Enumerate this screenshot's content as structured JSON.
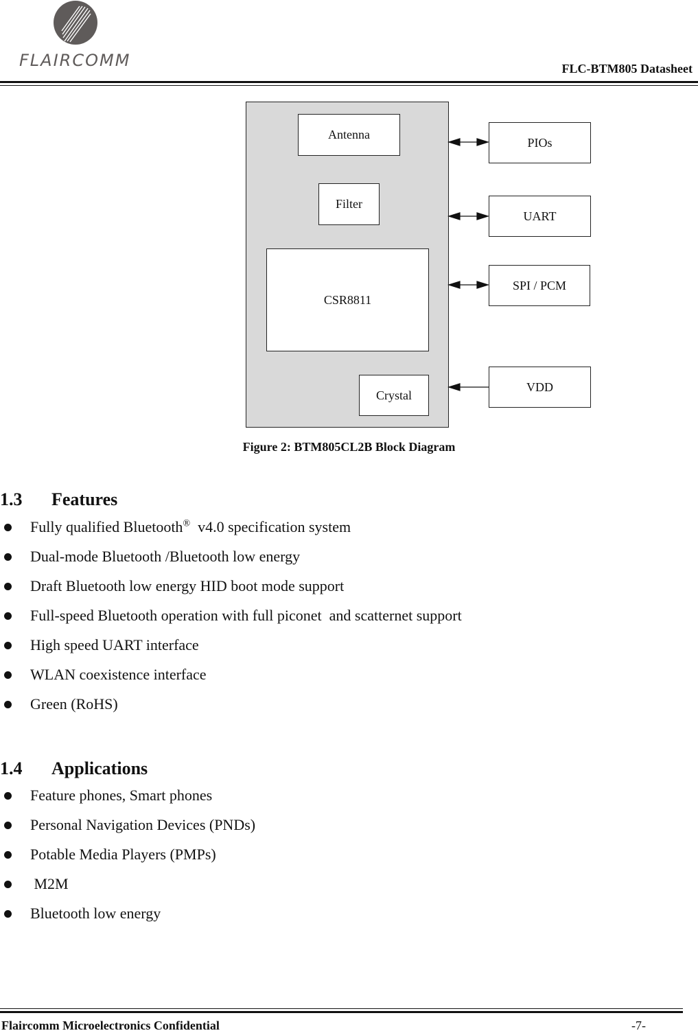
{
  "header": {
    "logo_text": "FLAIRCOMM",
    "doc_title": "FLC-BTM805 Datasheet"
  },
  "diagram": {
    "internal_blocks": [
      "Antenna",
      "Filter",
      "CSR8811",
      "Crystal"
    ],
    "external_blocks": [
      "PIOs",
      "UART",
      "SPI / PCM",
      "VDD"
    ],
    "connections": [
      {
        "to": "PIOs",
        "direction": "bidirectional"
      },
      {
        "to": "UART",
        "direction": "bidirectional"
      },
      {
        "to": "SPI / PCM",
        "direction": "bidirectional"
      },
      {
        "to": "VDD",
        "direction": "into-module"
      }
    ],
    "caption": "Figure 2: BTM805CL2B Block Diagram"
  },
  "features": {
    "number": "1.3",
    "title": "Features",
    "items": [
      {
        "text": "Fully qualified Bluetooth",
        "sup": "®",
        "rest": "  v4.0 specification system"
      },
      {
        "text": "Dual-mode Bluetooth /Bluetooth low energy"
      },
      {
        "text": "Draft Bluetooth low energy HID boot mode support"
      },
      {
        "text": "Full-speed Bluetooth operation with full piconet  and scatternet support"
      },
      {
        "text": "High speed UART interface"
      },
      {
        "text": "WLAN coexistence interface"
      },
      {
        "text": "Green (RoHS)"
      }
    ]
  },
  "applications": {
    "number": "1.4",
    "title": "Applications",
    "items": [
      {
        "text": "Feature phones, Smart phones"
      },
      {
        "text": "Personal Navigation Devices (PNDs)"
      },
      {
        "text": "Potable Media Players (PMPs)"
      },
      {
        "text": " M2M"
      },
      {
        "text": "Bluetooth low energy"
      }
    ]
  },
  "footer": {
    "confidential": "Flaircomm Microelectronics Confidential",
    "page": "-7-"
  }
}
